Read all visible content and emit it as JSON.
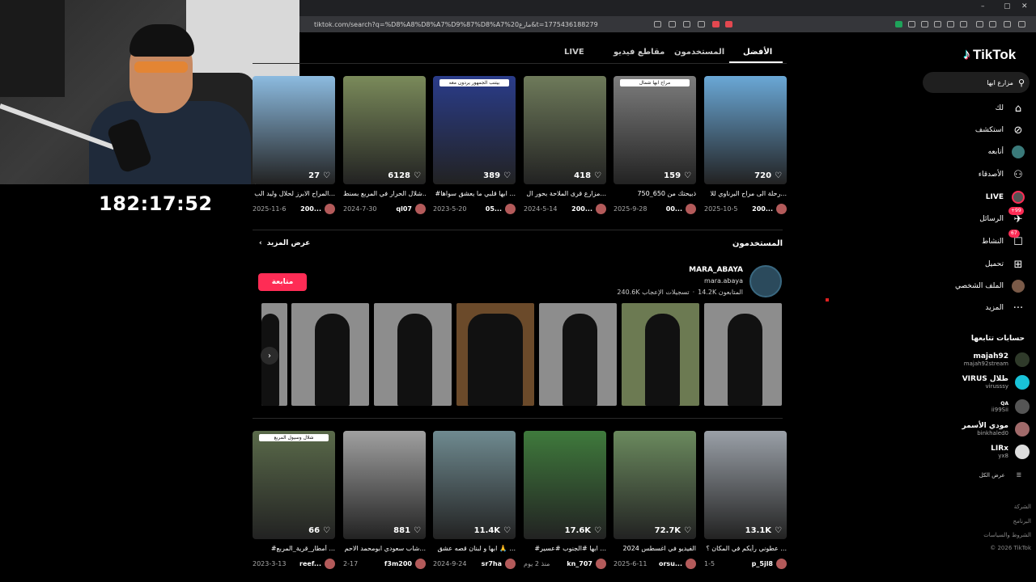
{
  "browser": {
    "url": "tiktok.com/search?q=%D8%A8%D8%A7%D9%87%D8%A7%20مارع&t=1775436188279",
    "window_controls": [
      "–",
      "▢",
      "✕"
    ]
  },
  "stream": {
    "timer": "182:17:52"
  },
  "sidebar": {
    "logo": "TikTok",
    "search_value": "مزارع ابها",
    "nav": [
      {
        "label": "لك",
        "icon": "home-icon"
      },
      {
        "label": "استكشف",
        "icon": "compass-icon"
      },
      {
        "label": "أتابعه",
        "icon": "following-avatar-icon"
      },
      {
        "label": "الأصدقاء",
        "icon": "friends-icon"
      },
      {
        "label": "LIVE",
        "icon": "live-icon"
      },
      {
        "label": "الرسائل",
        "icon": "messages-icon",
        "badge": "+99"
      },
      {
        "label": "النشاط",
        "icon": "activity-icon",
        "badge": "67"
      },
      {
        "label": "تحميل",
        "icon": "upload-icon"
      },
      {
        "label": "الملف الشخصي",
        "icon": "profile-avatar-icon"
      },
      {
        "label": "المزيد",
        "icon": "more-icon"
      }
    ],
    "following_title": "حسابات تتابعها",
    "accounts": [
      {
        "name": "majah92",
        "handle": "majah92stream"
      },
      {
        "name": "VIRUS طلال",
        "handle": "virusssy"
      },
      {
        "name": "QA",
        "handle": "ii99Sii"
      },
      {
        "name": "مودي الأسمر",
        "handle": "binkhaled0"
      },
      {
        "name": "LIRx",
        "handle": "yx8"
      }
    ],
    "see_all": "عرض الكل",
    "footer": [
      "الشركة",
      "البرنامج",
      "الشروط والسياسات",
      "© 2026 TikTok"
    ]
  },
  "tabs": [
    {
      "label": "الأفضل",
      "active": true
    },
    {
      "label": "المستخدمون"
    },
    {
      "label": "مقاطع فيديو"
    },
    {
      "label": "LIVE"
    }
  ],
  "top_videos": [
    {
      "views": "720",
      "desc": "رحلة الى مراح البرناوي للا...",
      "user": "200...",
      "date": "2025-10-5",
      "color": "#6aa8d6",
      "caption": ""
    },
    {
      "views": "159",
      "desc": "ذبيحتك من 650_750",
      "user": "00...",
      "date": "2025-9-28",
      "color": "#7d7d7d",
      "caption": "مراح ابها شمال"
    },
    {
      "views": "418",
      "desc": "مزارع قرى الملاحة بحور ال...",
      "user": "200...",
      "date": "2024-5-14",
      "color": "#6e7a5a",
      "caption": ""
    },
    {
      "views": "389",
      "desc": "#ابها قلبي ما يعشق سواها ...",
      "user": "05...",
      "date": "2023-5-20",
      "color": "#2a3c8a",
      "caption": "بيتنب الجمهور يردون معه"
    },
    {
      "views": "6128",
      "desc": "شلال الحرار في المربع بسنط...",
      "user": "ql07",
      "date": "2024-7-30",
      "color": "#7a8a5a",
      "caption": ""
    },
    {
      "views": "27",
      "desc": "المراح الابرز لحلال وليد الب...",
      "user": "200...",
      "date": "2025-11-6",
      "color": "#8cbbe0",
      "caption": ""
    }
  ],
  "users_section": {
    "title": "المستخدمون",
    "see_more": "عرض المزيد",
    "user": {
      "name": "MARA_ABAYA",
      "handle": "mara.abaya",
      "followers": "14.2K المتابعون",
      "likes": "240.6K تسجيلات الإعجاب",
      "follow_label": "متابعة"
    }
  },
  "bottom_videos": [
    {
      "views": "13.1K",
      "desc": "عطوني رأيكم في المكان ؟ ...",
      "user": "p_5jl8",
      "date": "1-5",
      "color": "#9aa0a8",
      "caption": ""
    },
    {
      "views": "72.7K",
      "desc": "الفيديو في اغسطس 2024",
      "user": "orsu...",
      "date": "2025-6-11",
      "color": "#6b8a5e",
      "caption": ""
    },
    {
      "views": "17.6K",
      "desc": "#ابها #الجنوب #عسير ...",
      "user": "kn_707",
      "date": "منذ 2 يوم",
      "color": "#3f7a3c",
      "caption": ""
    },
    {
      "views": "11.4K",
      "desc": "ابها و لبنان قصه عشق 🙏 ...",
      "user": "sr7ha",
      "date": "2024-9-24",
      "color": "#6f8a90",
      "caption": ""
    },
    {
      "views": "881",
      "desc": "شاب سعودي ابومحمد الاحم...",
      "user": "f3m200",
      "date": "2-17",
      "color": "#a0a0a0",
      "caption": ""
    },
    {
      "views": "66",
      "desc": "#أمطار_قرية_المربع ...",
      "user": "reef...",
      "date": "2023-3-13",
      "color": "#5a6a4a",
      "caption": "شلال وسيول المربع"
    }
  ]
}
